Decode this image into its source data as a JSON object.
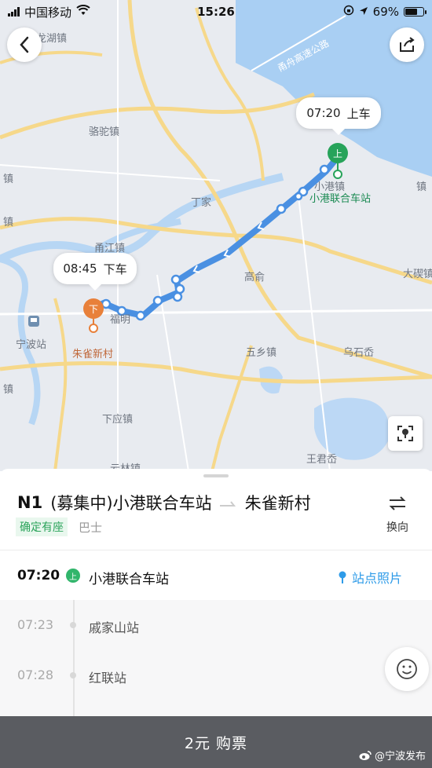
{
  "status_bar": {
    "carrier": "中国移动",
    "time": "15:26",
    "battery_text": "69%",
    "battery_level": 0.69
  },
  "map": {
    "places": {
      "longhu": "龙湖镇",
      "luotuo": "骆驼镇",
      "dingjia": "丁家",
      "gaoyu": "高俞",
      "dagi": "大碶镇",
      "wuxiang": "五乡镇",
      "wushi": "乌石岙",
      "ningbo_station": "宁波站",
      "xiaying": "下应镇",
      "wangjun": "王君岙",
      "xiaogang_town": "小港镇",
      "highway": "甬舟高速公路",
      "fuming": "福明",
      "yunlin": "云林镇",
      "zhen_left1": "镇",
      "zhen_left2": "镇",
      "zhen_left3": "镇",
      "zhen_right": "镇",
      "liangjiang": "甬江镇"
    },
    "board_station": "小港联合车站",
    "alight_station": "朱雀新村",
    "board_bubble": {
      "time": "07:20",
      "label": "上车"
    },
    "alight_bubble": {
      "time": "08:45",
      "label": "下车"
    },
    "board_pin": "上",
    "alight_pin": "下",
    "colors": {
      "route": "#4a90e2",
      "board": "#27a35a",
      "alight": "#e8803a",
      "water": "#a9cff3",
      "land": "#e8ebf0",
      "road": "#f6d88a"
    }
  },
  "route": {
    "code": "N1",
    "status": "(募集中)",
    "from": "小港联合车站",
    "arrow": "→",
    "to": "朱雀新村",
    "tag_seat": "确定有座",
    "tag_type": "巴士",
    "swap_label": "换向"
  },
  "stops": [
    {
      "time": "07:20",
      "badge": "上",
      "name": "小港联合车站"
    },
    {
      "time": "07:23",
      "name": "戚家山站"
    },
    {
      "time": "07:28",
      "name": "红联站"
    }
  ],
  "station_photos": "站点照片",
  "buy": {
    "label": "2元 购票"
  },
  "watermark": "@宁波发布"
}
